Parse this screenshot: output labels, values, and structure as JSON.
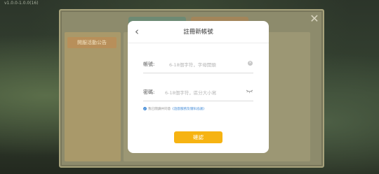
{
  "app": {
    "version": "v1.0.0-1.0.0(16)"
  },
  "modal": {
    "title": "註冊新帳號",
    "back_icon": "chevron-left-icon",
    "account": {
      "label": "帳號:",
      "placeholder": "6-18個字符，字母開頭"
    },
    "password": {
      "label": "密碼:",
      "placeholder": "6-18個字符，區分大小寫"
    },
    "agreement": {
      "prefix": "我已閱讀并同意",
      "link": "《遊戲服務及隱私協議》"
    },
    "confirm_label": "確認"
  },
  "background": {
    "side_tag": "開服活動公告",
    "close_icon": "close-icon"
  },
  "colors": {
    "accent": "#f6b312",
    "link": "#4a90d9"
  }
}
